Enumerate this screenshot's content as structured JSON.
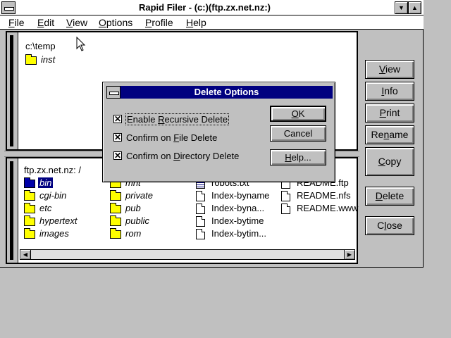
{
  "window": {
    "title": "Rapid Filer - (c:)(ftp.zx.net.nz:)",
    "minimize_glyph": "▼",
    "maximize_glyph": "▲"
  },
  "menu": {
    "items": [
      {
        "prefix": "",
        "ul": "F",
        "rest": "ile"
      },
      {
        "prefix": "",
        "ul": "E",
        "rest": "dit"
      },
      {
        "prefix": "",
        "ul": "V",
        "rest": "iew"
      },
      {
        "prefix": "",
        "ul": "O",
        "rest": "ptions"
      },
      {
        "prefix": "",
        "ul": "P",
        "rest": "rofile"
      },
      {
        "prefix": "",
        "ul": "H",
        "rest": "elp"
      }
    ]
  },
  "top_pane": {
    "path": "c:\\temp",
    "entries": [
      {
        "name": "inst",
        "type": "folder"
      }
    ]
  },
  "bottom_pane": {
    "path": "ftp.zx.net.nz: /",
    "col1": [
      {
        "name": "bin",
        "type": "folder",
        "selected": true
      },
      {
        "name": "cgi-bin",
        "type": "folder"
      },
      {
        "name": "etc",
        "type": "folder"
      },
      {
        "name": "hypertext",
        "type": "folder"
      },
      {
        "name": "images",
        "type": "folder"
      }
    ],
    "col2": [
      {
        "name": "mnt",
        "type": "folder"
      },
      {
        "name": "private",
        "type": "folder"
      },
      {
        "name": "pub",
        "type": "folder"
      },
      {
        "name": "public",
        "type": "folder"
      },
      {
        "name": "rom",
        "type": "folder"
      }
    ],
    "col3": [
      {
        "name": "robots.txt",
        "type": "textfile"
      },
      {
        "name": "Index-byname",
        "type": "file"
      },
      {
        "name": "Index-byna...",
        "type": "file"
      },
      {
        "name": "Index-bytime",
        "type": "file"
      },
      {
        "name": "Index-bytim...",
        "type": "file"
      }
    ],
    "col4": [
      {
        "name": "README.ftp",
        "type": "file"
      },
      {
        "name": "README.nfs",
        "type": "file"
      },
      {
        "name": "README.www",
        "type": "file"
      }
    ],
    "scroll_left_glyph": "◀",
    "scroll_right_glyph": "▶"
  },
  "side_buttons": {
    "view": {
      "prefix": "",
      "ul": "V",
      "rest": "iew"
    },
    "info": {
      "prefix": "",
      "ul": "I",
      "rest": "nfo"
    },
    "print": {
      "prefix": "",
      "ul": "P",
      "rest": "rint"
    },
    "rename": {
      "prefix": "Re",
      "ul": "n",
      "rest": "ame"
    },
    "copy": {
      "prefix": "",
      "ul": "C",
      "rest": "opy"
    },
    "delete": {
      "prefix": "",
      "ul": "D",
      "rest": "elete"
    },
    "close": {
      "prefix": "C",
      "ul": "l",
      "rest": "ose"
    }
  },
  "dialog": {
    "title": "Delete Options",
    "check_mark": "✕",
    "options": {
      "recursive": {
        "prefix": "Enable ",
        "ul": "R",
        "rest": "ecursive Delete",
        "checked": true
      },
      "file": {
        "prefix": "Confirm on ",
        "ul": "F",
        "rest": "ile Delete",
        "checked": true
      },
      "directory": {
        "prefix": "Confirm on ",
        "ul": "D",
        "rest": "irectory Delete",
        "checked": true
      }
    },
    "buttons": {
      "ok": {
        "prefix": "",
        "ul": "O",
        "rest": "K"
      },
      "cancel": {
        "label": "Cancel"
      },
      "help": {
        "prefix": "",
        "ul": "H",
        "rest": "elp..."
      }
    }
  }
}
